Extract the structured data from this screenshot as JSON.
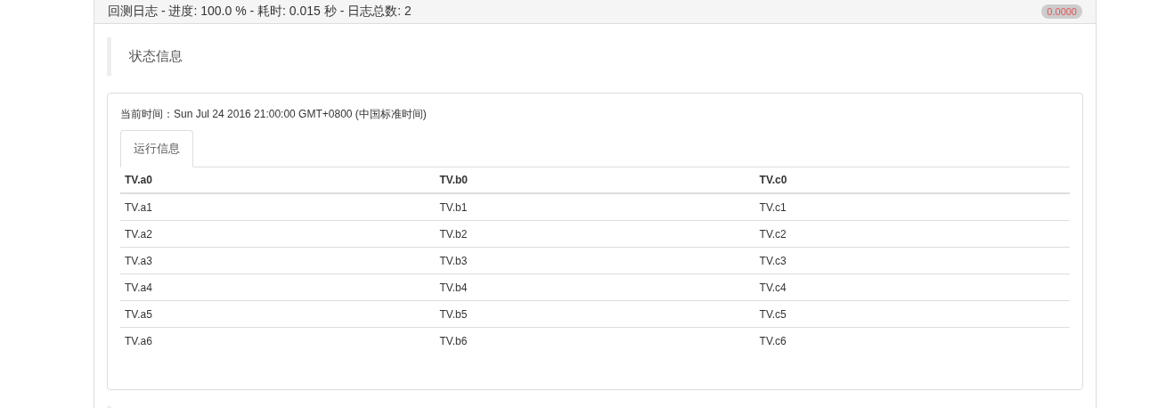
{
  "panel": {
    "title": "回测日志 - 进度: 100.0 % - 耗时: 0.015 秒 - 日志总数: 2",
    "badge": "0.0000"
  },
  "section": {
    "heading": "状态信息"
  },
  "card": {
    "time_label": "当前时间：",
    "time_value": "Sun Jul 24 2016 21:00:00 GMT+0800 (中国标准时间)",
    "tabs": [
      {
        "label": "运行信息",
        "selected": true
      }
    ],
    "table": {
      "columns": [
        "TV.a0",
        "TV.b0",
        "TV.c0"
      ],
      "rows": [
        [
          "TV.a1",
          "TV.b1",
          "TV.c1"
        ],
        [
          "TV.a2",
          "TV.b2",
          "TV.c2"
        ],
        [
          "TV.a3",
          "TV.b3",
          "TV.c3"
        ],
        [
          "TV.a4",
          "TV.b4",
          "TV.c4"
        ],
        [
          "TV.a5",
          "TV.b5",
          "TV.c5"
        ],
        [
          "TV.a6",
          "TV.b6",
          "TV.c6"
        ]
      ]
    }
  }
}
